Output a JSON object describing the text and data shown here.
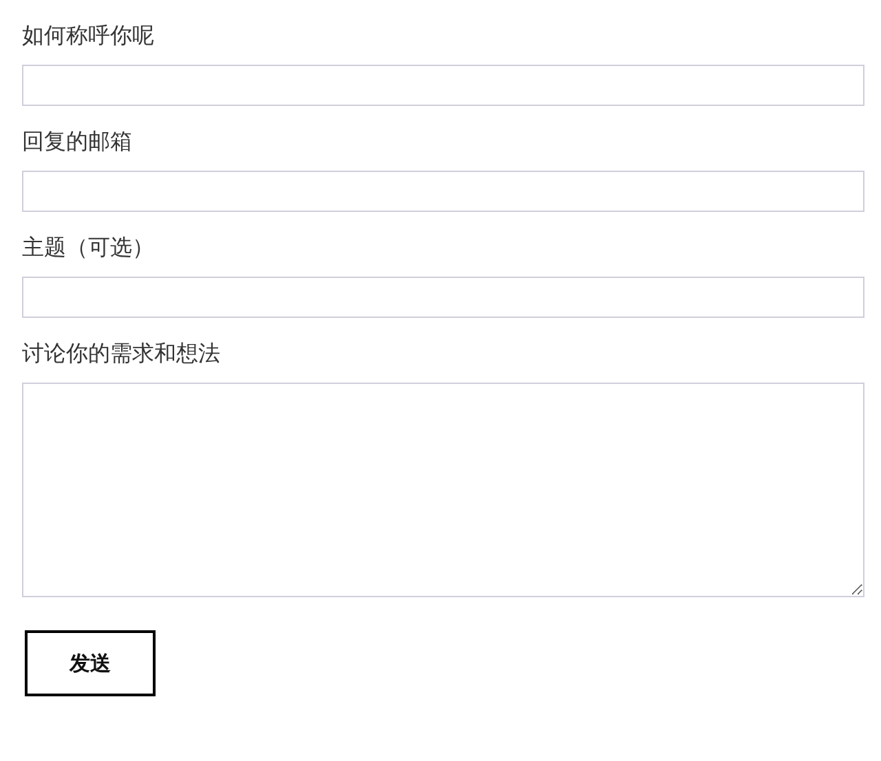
{
  "fields": [
    {
      "label": "如何称呼你呢",
      "kind": "input"
    },
    {
      "label": "回复的邮箱",
      "kind": "input"
    },
    {
      "label": "主题（可选）",
      "kind": "input"
    },
    {
      "label": "讨论你的需求和想法",
      "kind": "textarea"
    }
  ],
  "submit": {
    "label": "发送"
  }
}
